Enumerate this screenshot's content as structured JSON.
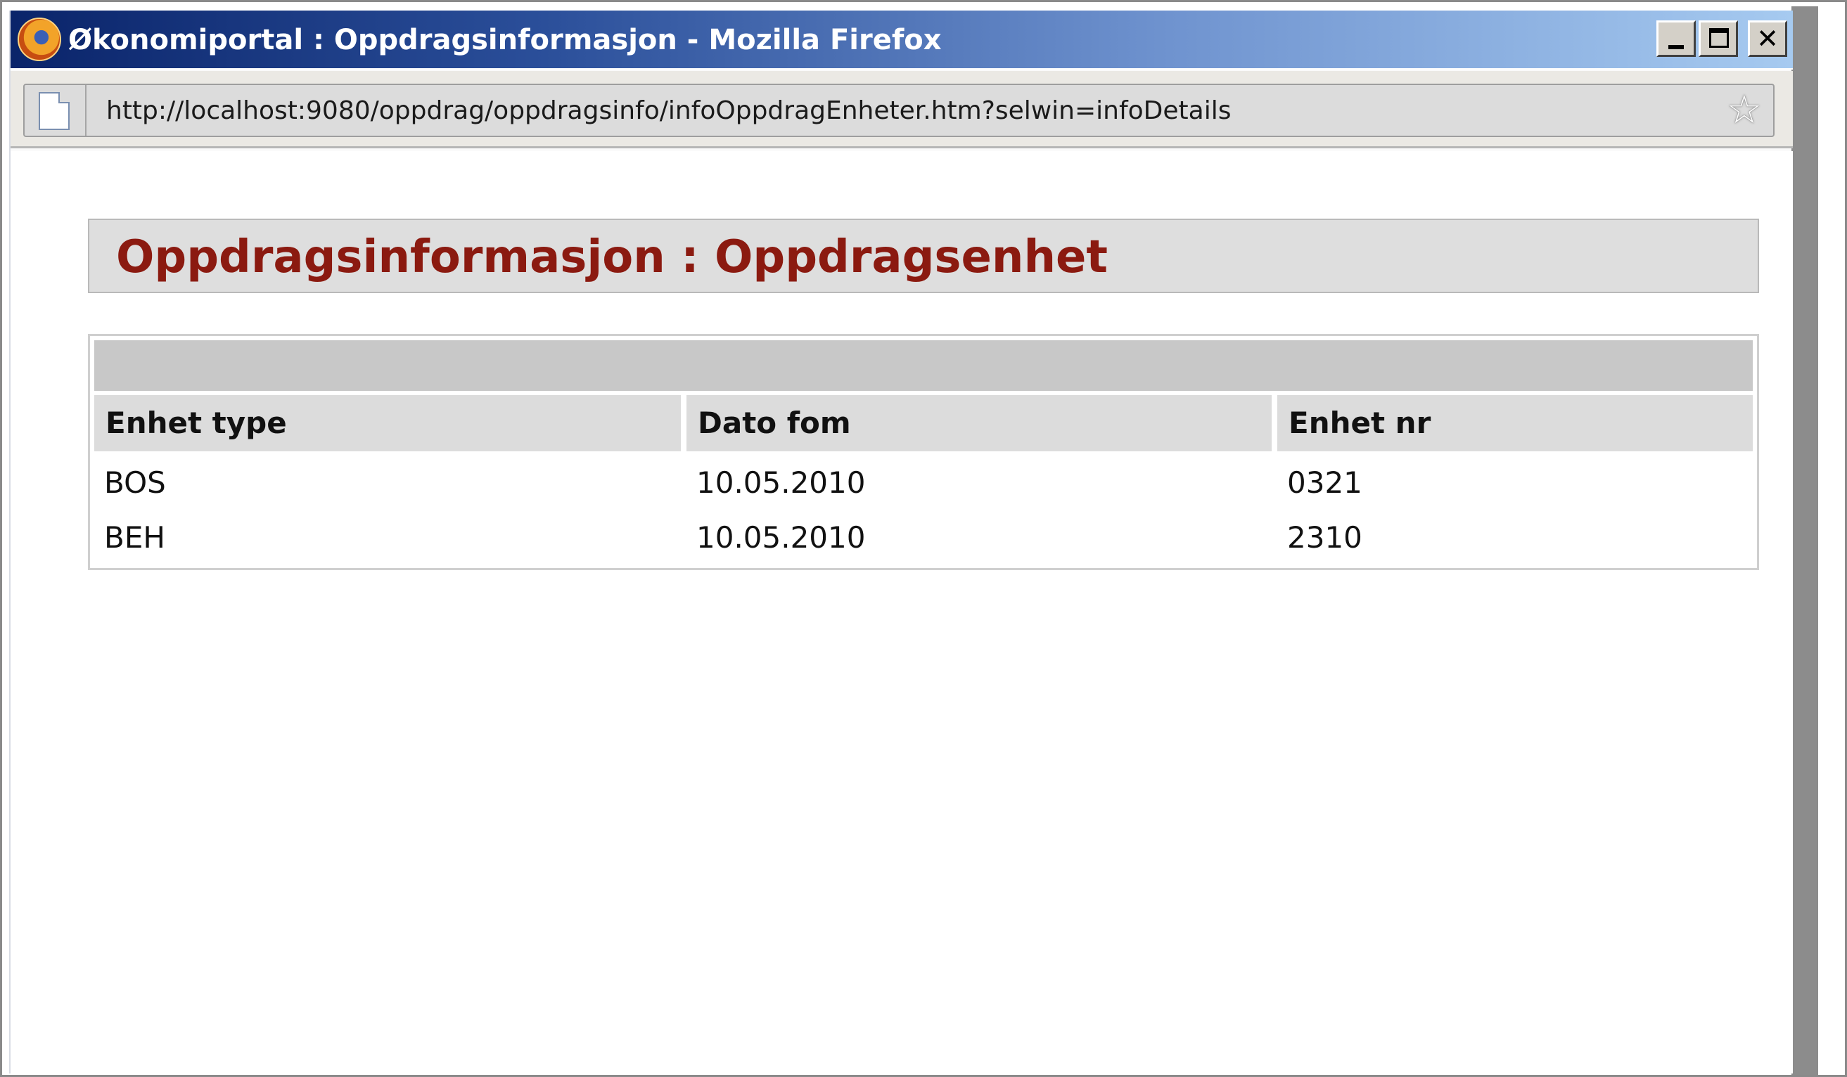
{
  "window": {
    "title": "Økonomiportal : Oppdragsinformasjon - Mozilla Firefox",
    "app_icon": "firefox-icon",
    "buttons": {
      "minimize": "minimize-icon",
      "maximize": "maximize-icon",
      "close": "✕"
    }
  },
  "addressbar": {
    "url": "http://localhost:9080/oppdrag/oppdragsinfo/infoOppdragEnheter.htm?selwin=infoDetails",
    "page_icon": "page-icon",
    "star_icon": "☆"
  },
  "main": {
    "title": "Oppdragsinformasjon : Oppdragsenhet",
    "title_color": "#8b1a10",
    "table": {
      "columns": [
        "Enhet type",
        "Dato fom",
        "Enhet nr"
      ],
      "rows": [
        [
          "BOS",
          "10.05.2010",
          "0321"
        ],
        [
          "BEH",
          "10.05.2010",
          "2310"
        ]
      ]
    }
  }
}
